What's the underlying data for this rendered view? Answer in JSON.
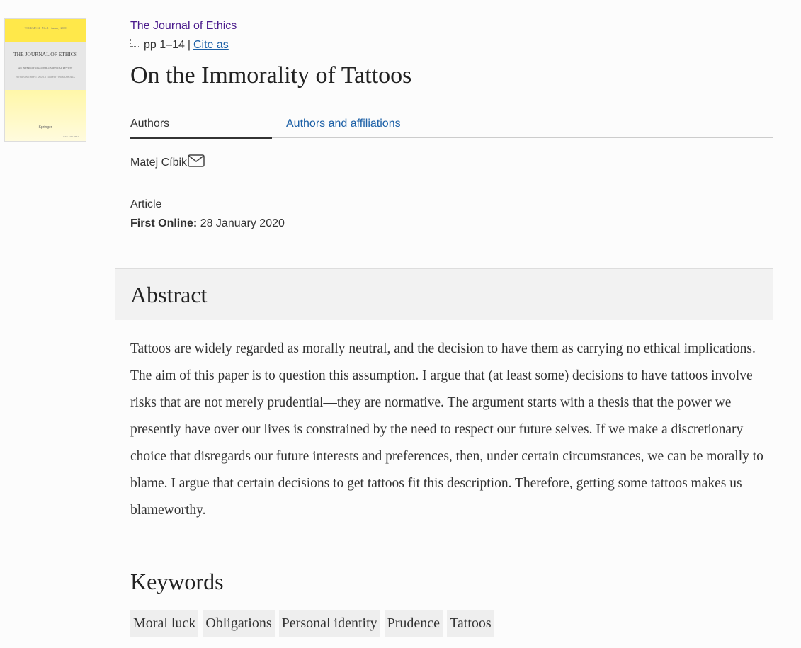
{
  "cover": {
    "volume_line": "VOLUME 24 · No. 1 · January 2020",
    "title": "THE JOURNAL OF ETHICS",
    "subtitle": "AN INTERNATIONAL PHILOSOPHICAL REVIEW",
    "editors": "EDITORS-IN-CHIEF: J. ANGELO CORLETT · THOMAS HURKA",
    "publisher": "Springer",
    "issn": "ISSN 1382-4554"
  },
  "journal": {
    "name": "The Journal of Ethics",
    "pages": "pp 1–14",
    "separator": "|",
    "cite_label": "Cite as"
  },
  "article": {
    "title": "On the Immorality of Tattoos",
    "type": "Article",
    "first_online_label": "First Online:",
    "first_online_date": "28 January 2020"
  },
  "tabs": {
    "authors": "Authors",
    "affiliations": "Authors and affiliations"
  },
  "author": {
    "name": "Matej Cíbik",
    "email_icon": "envelope-icon"
  },
  "abstract": {
    "heading": "Abstract",
    "text": "Tattoos are widely regarded as morally neutral, and the decision to have them as carrying no ethical implications. The aim of this paper is to question this assumption. I argue that (at least some) decisions to have tattoos involve risks that are not merely prudential—they are normative. The argument starts with a thesis that the power we presently have over our lives is constrained by the need to respect our future selves. If we make a discretionary choice that disregards our future interests and preferences, then, under certain circumstances, we can be morally to blame. I argue that certain decisions to get tattoos fit this description. Therefore, getting some tattoos makes us blameworthy."
  },
  "keywords": {
    "heading": "Keywords",
    "items": [
      "Moral luck",
      "Obligations",
      "Personal identity",
      "Prudence",
      "Tattoos"
    ]
  }
}
